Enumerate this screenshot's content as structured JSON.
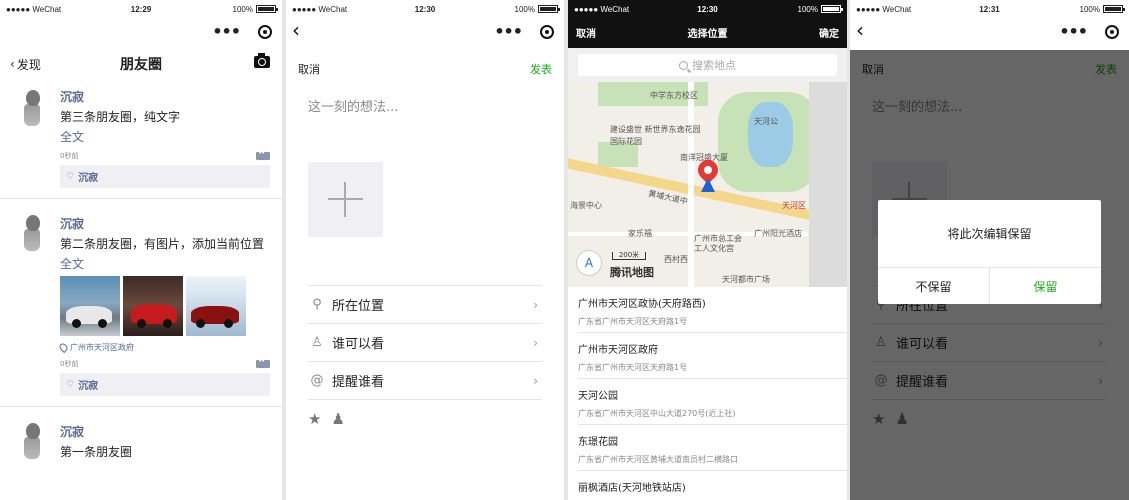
{
  "status": {
    "carrier": "●●●●● WeChat",
    "battery": "100%",
    "times": [
      "12:29",
      "12:30",
      "12:30",
      "12:31"
    ]
  },
  "feed": {
    "back_label": "发现",
    "title": "朋友圈",
    "posts": [
      {
        "user": "沉寂",
        "text": "第三条朋友圈，纯文字",
        "fulltext": "全文",
        "time": "0秒前",
        "likes": "沉寂",
        "location": ""
      },
      {
        "user": "沉寂",
        "text": "第二条朋友圈，有图片，添加当前位置",
        "fulltext": "全文",
        "time": "0秒前",
        "likes": "沉寂",
        "location": "广州市天河区政府"
      },
      {
        "user": "沉寂",
        "text": "第一条朋友圈",
        "fulltext": "",
        "time": "",
        "likes": "",
        "location": ""
      }
    ]
  },
  "compose": {
    "cancel": "取消",
    "publish": "发表",
    "placeholder": "这一刻的想法...",
    "rows": [
      {
        "icon": "location-icon",
        "label": "所在位置"
      },
      {
        "icon": "person-icon",
        "label": "谁可以看"
      },
      {
        "icon": "at-icon",
        "label": "提醒谁看"
      }
    ]
  },
  "location": {
    "cancel": "取消",
    "title": "选择位置",
    "confirm": "确定",
    "search_placeholder": "搜索地点",
    "map_labels": {
      "school": "中学东方校区",
      "mall": "建设盛世 新世界东逸花园",
      "mall2": "国际花园",
      "building": "南洋冠盛大厦",
      "park": "天河公",
      "road": "黄埔大道中",
      "district": "天河区",
      "center": "海景中心",
      "carrefour": "家乐福",
      "culture": "广州市总工会 工人文化宫",
      "hotel": "广州阳光酒店",
      "plaza": "天河都市广场",
      "west": "西村西",
      "scale": "200米",
      "brand": "腾讯地图"
    },
    "places": [
      {
        "name": "广州市天河区政协(天府路西)",
        "address": "广东省广州市天河区天府路1号"
      },
      {
        "name": "广州市天河区政府",
        "address": "广东省广州市天河区天府路1号"
      },
      {
        "name": "天河公园",
        "address": "广东省广州市天河区中山大道270号(近上社)"
      },
      {
        "name": "东璟花园",
        "address": "广东省广州市天河区黄埔大道南员村二横路口"
      },
      {
        "name": "丽枫酒店(天河地铁站店)",
        "address": ""
      }
    ]
  },
  "dialog": {
    "title": "将此次编辑保留",
    "discard": "不保留",
    "keep": "保留"
  },
  "colors": {
    "link": "#576b95",
    "accent": "#1aad19"
  }
}
